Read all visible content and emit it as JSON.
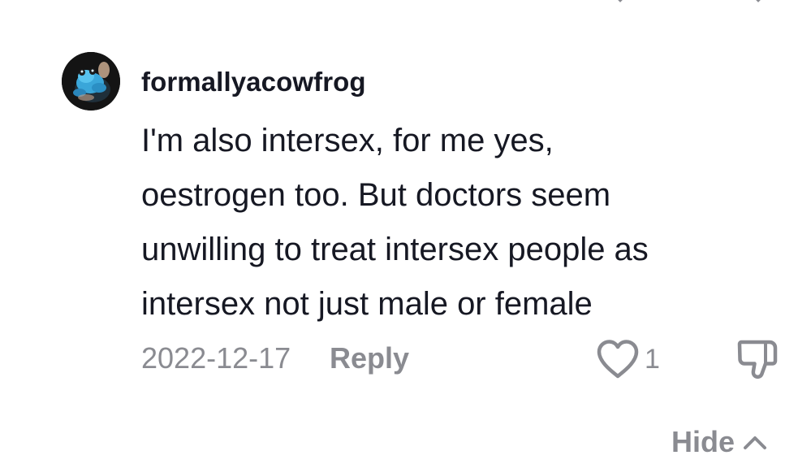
{
  "comment": {
    "username": "formallyacowfrog",
    "avatar_icon": "blue-frog-figure-avatar",
    "text_lines": [
      "I'm also intersex, for me yes,",
      "oestrogen too. But doctors seem",
      "unwilling to treat intersex people as",
      "intersex not just male or female"
    ],
    "date": "2022-12-17",
    "reply_label": "Reply",
    "like_icon": "heart-outline-icon",
    "like_count": "1",
    "dislike_icon": "thumbs-down-icon"
  },
  "thread": {
    "hide_label": "Hide",
    "hide_icon": "chevron-up-icon"
  },
  "colors": {
    "text_primary": "#161823",
    "text_secondary": "#8a8b91",
    "background": "#ffffff"
  }
}
